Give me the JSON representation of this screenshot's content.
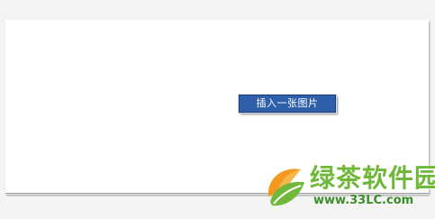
{
  "button": {
    "label": "插入一张图片"
  },
  "watermark": {
    "site_name": "绿茶软件园",
    "site_url": "www.33LC.com"
  },
  "colors": {
    "button_bg": "#2e5fa8",
    "watermark_green": "#6fb83a",
    "watermark_orange": "#f39a1e"
  }
}
